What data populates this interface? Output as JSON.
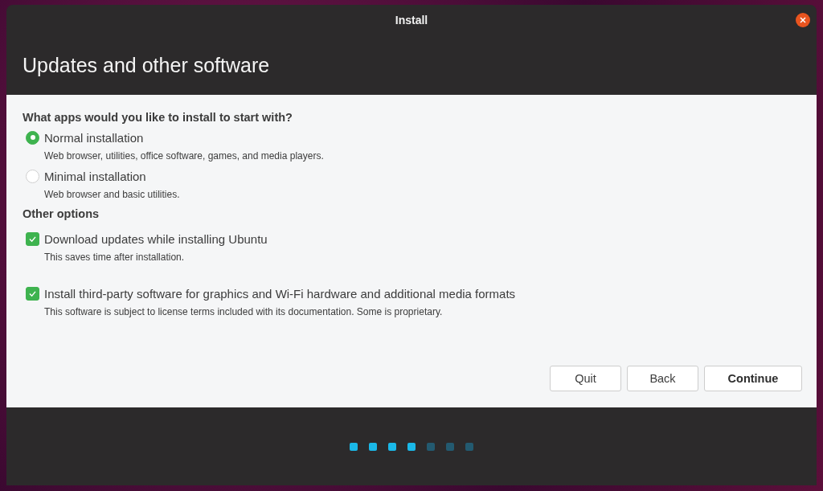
{
  "window": {
    "title": "Install"
  },
  "page_title": "Updates and other software",
  "install_type": {
    "heading": "What apps would you like to install to start with?",
    "options": [
      {
        "label": "Normal installation",
        "description": "Web browser, utilities, office software, games, and media players.",
        "selected": true
      },
      {
        "label": "Minimal installation",
        "description": "Web browser and basic utilities.",
        "selected": false
      }
    ]
  },
  "other_options": {
    "heading": "Other options",
    "options": [
      {
        "label": "Download updates while installing Ubuntu",
        "description": "This saves time after installation.",
        "checked": true
      },
      {
        "label": "Install third-party software for graphics and Wi-Fi hardware and additional media formats",
        "description": "This software is subject to license terms included with its documentation. Some is proprietary.",
        "checked": true
      }
    ]
  },
  "buttons": [
    {
      "label": "Quit",
      "default": false
    },
    {
      "label": "Back",
      "default": false
    },
    {
      "label": "Continue",
      "default": true
    }
  ],
  "progress_steps": [
    {
      "completed": true
    },
    {
      "completed": true
    },
    {
      "completed": true
    },
    {
      "completed": true
    },
    {
      "completed": false
    },
    {
      "completed": false
    },
    {
      "completed": false
    }
  ]
}
